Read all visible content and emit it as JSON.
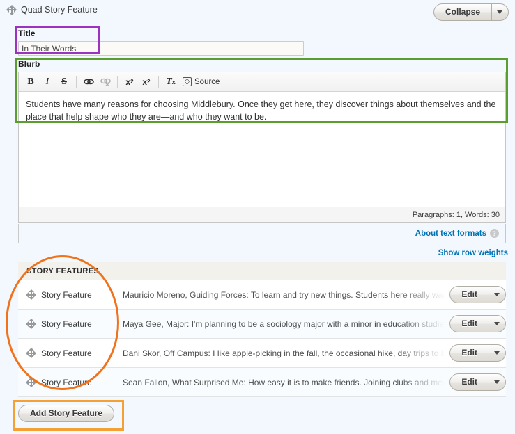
{
  "panel": {
    "legend": "Quad Story Feature",
    "drag_icon": "drag-handle-icon",
    "collapse_label": "Collapse"
  },
  "title_field": {
    "label": "Title",
    "value": "In Their Words",
    "placeholder": ""
  },
  "blurb_field": {
    "label": "Blurb",
    "body_text": "Students have many reasons for choosing Middlebury. Once they get here, they discover things about themselves and the place that help shape who they are—and who they want to be.",
    "status": "Paragraphs: 1, Words: 30",
    "toolbar": [
      {
        "name": "bold-icon",
        "glyph": "B",
        "enabled": true
      },
      {
        "name": "italic-icon",
        "glyph": "I",
        "enabled": true
      },
      {
        "name": "strikethrough-icon",
        "glyph": "S",
        "enabled": true
      },
      {
        "name": "link-icon",
        "glyph": "⚭",
        "enabled": true
      },
      {
        "name": "unlink-icon",
        "glyph": "⚭",
        "enabled": false
      },
      {
        "name": "superscript-icon",
        "glyph": "x²",
        "enabled": true
      },
      {
        "name": "subscript-icon",
        "glyph": "x₂",
        "enabled": true
      },
      {
        "name": "remove-format-icon",
        "glyph": "Tₓ",
        "enabled": true
      }
    ],
    "source_label": "Source",
    "source_icon": "source-code-icon"
  },
  "format_row": {
    "about_label": "About text formats",
    "help_icon": "question-mark-icon",
    "help_glyph": "?"
  },
  "show_row_weights": "Show row weights",
  "features_table": {
    "header": "STORY FEATURES",
    "row_label": "Story Feature",
    "edit_label": "Edit",
    "rows": [
      {
        "label": "Story Feature",
        "description": "Mauricio Moreno, Guiding Forces: To learn and try new things. Students here really want to"
      },
      {
        "label": "Story Feature",
        "description": "Maya Gee, Major: I'm planning to be a sociology major with a minor in education studies w"
      },
      {
        "label": "Story Feature",
        "description": "Dani Skor, Off Campus: I like apple-picking in the fall, the occasional hike, day trips to Burl"
      },
      {
        "label": "Story Feature",
        "description": "Sean Fallon, What Surprised Me: How easy it is to make friends. Joining clubs and meeting s"
      }
    ]
  },
  "add_button": {
    "label": "Add Story Feature"
  },
  "annotations": {
    "title_highlight_color": "#9c32c0",
    "blurb_highlight_color": "#5a9e2f",
    "features_highlight_color": "#f0731b",
    "add_button_highlight_color": "#f5a035"
  }
}
